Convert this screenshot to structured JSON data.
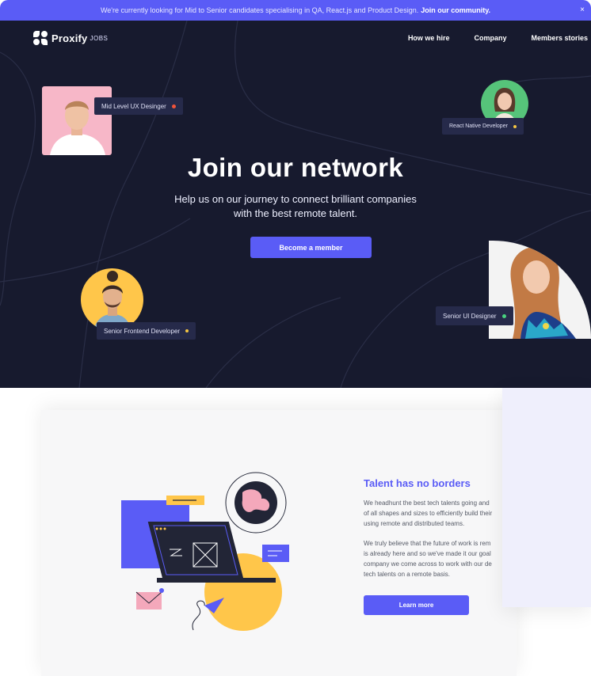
{
  "announcement": {
    "text": "We're currently looking for Mid to Senior candidates specialising in QA, React.js and Product Design.",
    "link": "Join our community.",
    "close": "×"
  },
  "nav": {
    "logo": "Proxify",
    "logo_suffix": "JOBS",
    "links": [
      "How we hire",
      "Company",
      "Members stories"
    ]
  },
  "hero": {
    "title": "Join our network",
    "subtitle_line1": "Help us on our journey to connect brilliant companies",
    "subtitle_line2": "with the best remote talent.",
    "cta": "Become a member"
  },
  "profiles": [
    {
      "role": "Mid Level UX Desinger",
      "dot_color": "#f0533a",
      "bg_color": "#f7b7c8"
    },
    {
      "role": "React Native Developer",
      "dot_color": "#f5c542",
      "bg_color": "#56c47a"
    },
    {
      "role": "Senior Frontend Developer",
      "dot_color": "#f5c542",
      "bg_color": "#ffc64a"
    },
    {
      "role": "Senior UI Designer",
      "dot_color": "#48d27f",
      "bg_color": "#f3f3f3"
    }
  ],
  "section": {
    "title": "Talent has no borders",
    "para1": [
      "We headhunt the best tech talents going and",
      "of all shapes and sizes to efficiently build their",
      "using remote and distributed teams."
    ],
    "para2": [
      "We truly believe that the future of work is rem",
      "is already here and so we've made it our goal",
      "company we come across to work with our de",
      "tech talents on a remote basis."
    ],
    "button": "Learn more"
  },
  "colors": {
    "accent": "#5a5cf6",
    "hero_bg": "#171a2e",
    "tag_bg": "#262a4a"
  }
}
